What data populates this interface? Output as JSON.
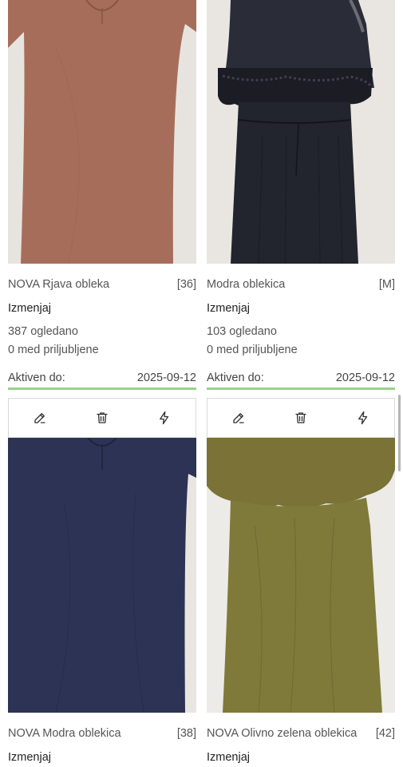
{
  "listings": [
    {
      "title": "NOVA Rjava obleka",
      "size": "[36]",
      "brand": "Izmenjaj",
      "views": "387 ogledano",
      "favorites": "0 med priljubljene",
      "active_label": "Aktiven do:",
      "active_date": "2025-09-12",
      "color": "#a66e5a"
    },
    {
      "title": "Modra oblekica",
      "size": "[M]",
      "brand": "Izmenjaj",
      "views": "103 ogledano",
      "favorites": "0 med priljubljene",
      "active_label": "Aktiven do:",
      "active_date": "2025-09-12",
      "color": "#22242e"
    },
    {
      "title": "NOVA Modra oblekica",
      "size": "[38]",
      "brand": "Izmenjaj",
      "color": "#2c3354"
    },
    {
      "title": "NOVA Olivno zelena oblekica",
      "size": "[42]",
      "brand": "Izmenjaj",
      "color": "#7f7a3a"
    }
  ],
  "actions": {
    "edit": "pencil-icon",
    "delete": "trash-icon",
    "boost": "lightning-icon"
  }
}
